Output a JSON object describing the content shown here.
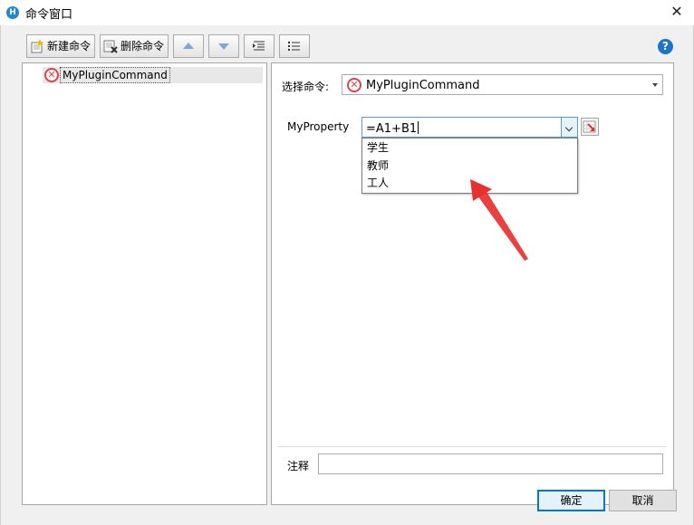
{
  "window": {
    "title": "命令窗口"
  },
  "toolbar": {
    "new_command": "新建命令",
    "delete_command": "删除命令"
  },
  "tree": {
    "items": [
      {
        "label": "MyPluginCommand"
      }
    ]
  },
  "editor": {
    "select_label": "选择命令:",
    "selected_command": "MyPluginCommand",
    "property_label": "MyProperty",
    "property_value": "=A1+B1",
    "dropdown_options": [
      "学生",
      "教师",
      "工人"
    ],
    "note_label": "注释",
    "note_value": ""
  },
  "footer": {
    "ok": "确定",
    "cancel": "取消"
  },
  "colors": {
    "accent": "#0078d7",
    "error": "#d9424a",
    "annotation_arrow": "#e8302f"
  }
}
